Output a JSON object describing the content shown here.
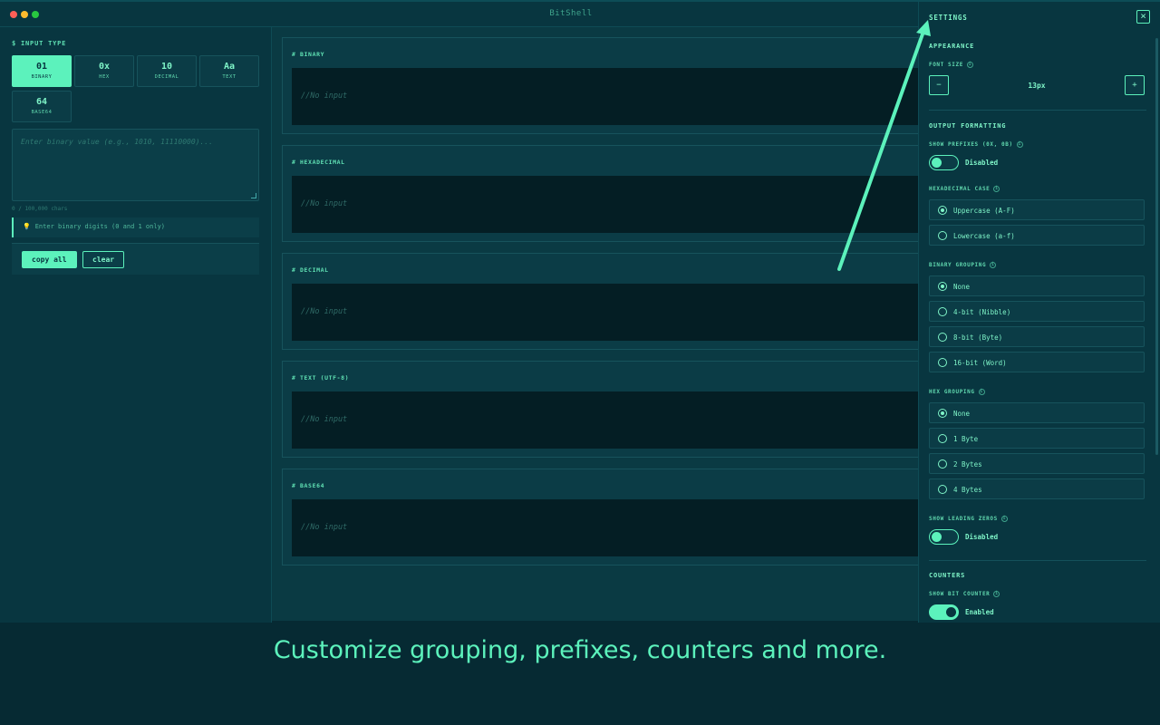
{
  "app": {
    "title": "BitShell"
  },
  "input_panel": {
    "section_label": "$ INPUT TYPE",
    "types": [
      {
        "symbol": "01",
        "label": "BINARY",
        "active": true
      },
      {
        "symbol": "0x",
        "label": "HEX",
        "active": false
      },
      {
        "symbol": "10",
        "label": "DECIMAL",
        "active": false
      },
      {
        "symbol": "Aa",
        "label": "TEXT",
        "active": false
      },
      {
        "symbol": "64",
        "label": "BASE64",
        "active": false
      }
    ],
    "placeholder": "Enter binary value (e.g., 1010, 11110000)...",
    "char_count": "0 / 100,000 chars",
    "hint": "Enter binary digits (0 and 1 only)",
    "copy_label": "copy all",
    "clear_label": "clear"
  },
  "outputs": [
    {
      "label": "# BINARY",
      "value": "//No input"
    },
    {
      "label": "# HEXADECIMAL",
      "value": "//No input"
    },
    {
      "label": "# DECIMAL",
      "value": "//No input"
    },
    {
      "label": "# TEXT (UTF-8)",
      "value": "//No input"
    },
    {
      "label": "# BASE64",
      "value": "//No input"
    }
  ],
  "settings": {
    "title": "SETTINGS",
    "appearance": "APPEARANCE",
    "font_size_label": "FONT SIZE",
    "font_size_value": "13px",
    "minus": "−",
    "plus": "+",
    "output_formatting": "OUTPUT FORMATTING",
    "show_prefixes_label": "SHOW PREFIXES (0X, 0B)",
    "show_prefixes_state": "Disabled",
    "hex_case_label": "HEXADECIMAL CASE",
    "hex_case_options": [
      "Uppercase (A-F)",
      "Lowercase (a-f)"
    ],
    "binary_grouping_label": "BINARY GROUPING",
    "binary_grouping_options": [
      "None",
      "4-bit (Nibble)",
      "8-bit (Byte)",
      "16-bit (Word)"
    ],
    "hex_grouping_label": "HEX GROUPING",
    "hex_grouping_options": [
      "None",
      "1 Byte",
      "2 Bytes",
      "4 Bytes"
    ],
    "leading_zeros_label": "SHOW LEADING ZEROS",
    "leading_zeros_state": "Disabled",
    "counters": "COUNTERS",
    "bit_counter_label": "SHOW BIT COUNTER",
    "bit_counter_state": "Enabled"
  },
  "caption": "Customize grouping, prefixes, counters and more.",
  "colors": {
    "accent": "#5cf2bc",
    "background": "#062a33",
    "panel": "#083640"
  }
}
